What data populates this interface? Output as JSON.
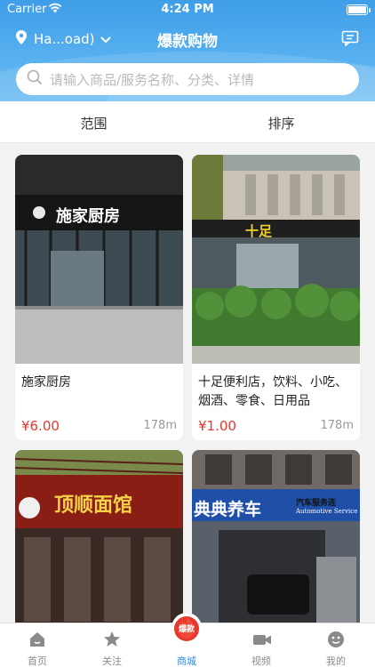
{
  "status": {
    "carrier": "Carrier",
    "time": "4:24 PM"
  },
  "nav": {
    "location": "Ha...oad)",
    "title": "爆款购物"
  },
  "search": {
    "placeholder": "请输入商品/服务名称、分类、详情"
  },
  "filters": {
    "range": "范围",
    "sort": "排序"
  },
  "products": [
    {
      "name": "施家厨房",
      "price": "¥6.00",
      "distance": "178m",
      "sign": "施家厨房"
    },
    {
      "name": "十足便利店，饮料、小吃、烟酒、零食、日用品",
      "price": "¥1.00",
      "distance": "178m",
      "sign": "十足"
    },
    {
      "sign": "顶顺面馆"
    },
    {
      "sign": "典典养车",
      "sign_sub": "汽车服务连",
      "sign_en": "Automotive Service"
    }
  ],
  "tabs": [
    {
      "label": "首页"
    },
    {
      "label": "关注"
    },
    {
      "label": "商城",
      "badge": "爆款"
    },
    {
      "label": "视频"
    },
    {
      "label": "我的"
    }
  ],
  "colors": {
    "primary": "#3f9ee8",
    "price": "#e8372c",
    "active_tab": "#3d8ce0",
    "badge": "#e8372c"
  }
}
